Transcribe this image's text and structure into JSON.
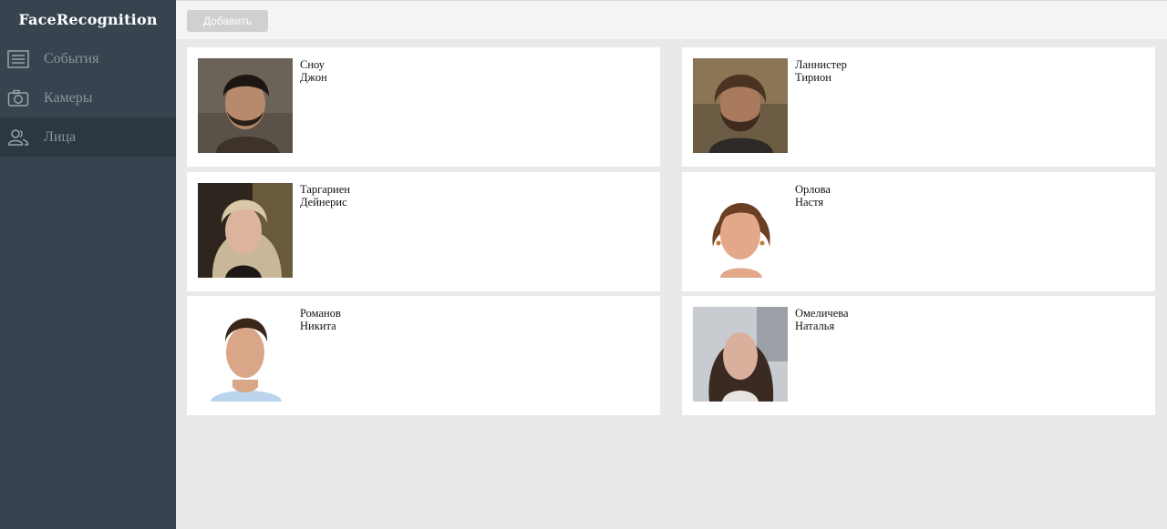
{
  "app": {
    "title": "FaceRecognition"
  },
  "sidebar": {
    "items": [
      {
        "label": "События",
        "icon": "list-icon",
        "active": false
      },
      {
        "label": "Камеры",
        "icon": "camera-icon",
        "active": false
      },
      {
        "label": "Лица",
        "icon": "faces-icon",
        "active": true
      }
    ]
  },
  "toolbar": {
    "add_label": "Добавить"
  },
  "faces": [
    {
      "last": "Сноу",
      "first": "Джон"
    },
    {
      "last": "Ланнистер",
      "first": "Тирион"
    },
    {
      "last": "Таргариен",
      "first": "Дейнерис"
    },
    {
      "last": "Орлова",
      "first": "Настя"
    },
    {
      "last": "Романов",
      "first": "Никита"
    },
    {
      "last": "Омеличева",
      "first": "Наталья"
    }
  ]
}
